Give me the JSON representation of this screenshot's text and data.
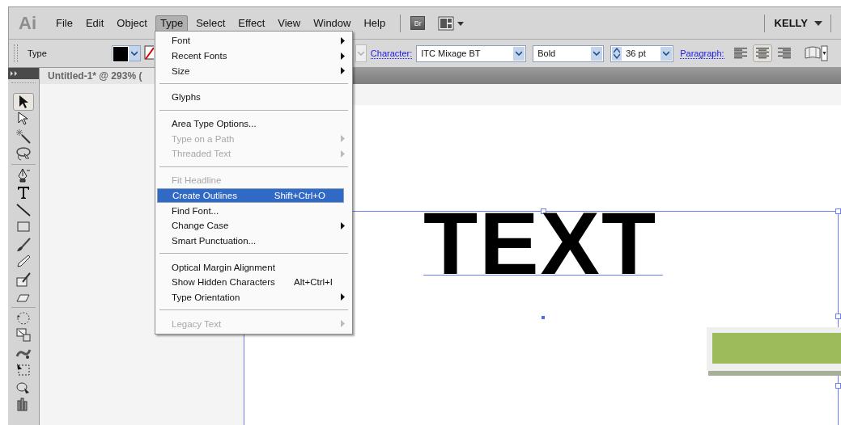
{
  "menubar": {
    "logo": "Ai",
    "items": [
      {
        "label": "File",
        "selected": false
      },
      {
        "label": "Edit",
        "selected": false
      },
      {
        "label": "Object",
        "selected": false
      },
      {
        "label": "Type",
        "selected": true
      },
      {
        "label": "Select",
        "selected": false
      },
      {
        "label": "Effect",
        "selected": false
      },
      {
        "label": "View",
        "selected": false
      },
      {
        "label": "Window",
        "selected": false
      },
      {
        "label": "Help",
        "selected": false
      }
    ],
    "bridge": "Br",
    "workspace": "KELLY"
  },
  "control_bar": {
    "label": "Type",
    "character_link": "Character:",
    "font": "ITC Mixage BT",
    "style": "Bold",
    "size": "36 pt",
    "paragraph_link": "Paragraph:",
    "align": [
      {
        "kind": "left",
        "selected": false
      },
      {
        "kind": "center",
        "selected": true
      },
      {
        "kind": "right",
        "selected": false
      }
    ]
  },
  "document_tab": "Untitled-1* @ 293% (",
  "tools": [
    {
      "kind": "selection",
      "selected": true
    },
    {
      "kind": "direct-selection",
      "selected": false
    },
    {
      "kind": "magic-wand",
      "selected": false
    },
    {
      "kind": "lasso",
      "selected": false
    },
    {
      "kind": "separator"
    },
    {
      "kind": "pen",
      "selected": false
    },
    {
      "kind": "type",
      "selected": false
    },
    {
      "kind": "line",
      "selected": false
    },
    {
      "kind": "rectangle",
      "selected": false
    },
    {
      "kind": "paintbrush",
      "selected": false
    },
    {
      "kind": "pencil",
      "selected": false
    },
    {
      "kind": "blob-brush",
      "selected": false
    },
    {
      "kind": "eraser",
      "selected": false
    },
    {
      "kind": "separator"
    },
    {
      "kind": "rotate",
      "selected": false
    },
    {
      "kind": "scale",
      "selected": false
    },
    {
      "kind": "warp",
      "selected": false
    },
    {
      "kind": "free-transform",
      "selected": false
    },
    {
      "kind": "symbol-sprayer",
      "selected": false
    },
    {
      "kind": "graph",
      "selected": false
    }
  ],
  "artboard_text": "TEXT",
  "type_menu": [
    {
      "kind": "item",
      "label": "Font",
      "submenu": true,
      "disabled": false,
      "selected": false
    },
    {
      "kind": "item",
      "label": "Recent Fonts",
      "submenu": true,
      "disabled": false,
      "selected": false
    },
    {
      "kind": "item",
      "label": "Size",
      "submenu": true,
      "disabled": false,
      "selected": false
    },
    {
      "kind": "separator"
    },
    {
      "kind": "item",
      "label": "Glyphs",
      "submenu": false,
      "disabled": false,
      "selected": false
    },
    {
      "kind": "separator"
    },
    {
      "kind": "item",
      "label": "Area Type Options...",
      "submenu": false,
      "disabled": false,
      "selected": false
    },
    {
      "kind": "item",
      "label": "Type on a Path",
      "submenu": true,
      "disabled": true,
      "selected": false
    },
    {
      "kind": "item",
      "label": "Threaded Text",
      "submenu": true,
      "disabled": true,
      "selected": false
    },
    {
      "kind": "separator"
    },
    {
      "kind": "item",
      "label": "Fit Headline",
      "submenu": false,
      "disabled": true,
      "selected": false
    },
    {
      "kind": "item",
      "label": "Create Outlines",
      "shortcut": "Shift+Ctrl+O",
      "submenu": false,
      "disabled": false,
      "selected": true
    },
    {
      "kind": "item",
      "label": "Find Font...",
      "submenu": false,
      "disabled": false,
      "selected": false
    },
    {
      "kind": "item",
      "label": "Change Case",
      "submenu": true,
      "disabled": false,
      "selected": false
    },
    {
      "kind": "item",
      "label": "Smart Punctuation...",
      "submenu": false,
      "disabled": false,
      "selected": false
    },
    {
      "kind": "separator"
    },
    {
      "kind": "item",
      "label": "Optical Margin Alignment",
      "submenu": false,
      "disabled": false,
      "selected": false
    },
    {
      "kind": "item",
      "label": "Show Hidden Characters",
      "shortcut": "Alt+Ctrl+I",
      "submenu": false,
      "disabled": false,
      "selected": false
    },
    {
      "kind": "item",
      "label": "Type Orientation",
      "submenu": true,
      "disabled": false,
      "selected": false
    },
    {
      "kind": "separator"
    },
    {
      "kind": "item",
      "label": "Legacy Text",
      "submenu": true,
      "disabled": true,
      "selected": false
    }
  ]
}
